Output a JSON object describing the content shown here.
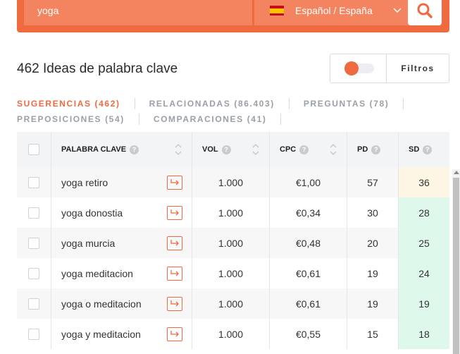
{
  "search": {
    "query": "yoga",
    "language": "Español / España",
    "flag_icon": "spain-flag-icon",
    "accent_color": "#f06a3f"
  },
  "header": {
    "ideas_title": "462 Ideas de palabra clave",
    "filters_label": "Filtros"
  },
  "tabs": [
    {
      "label": "SUGERENCIAS (462)",
      "active": true
    },
    {
      "label": "RELACIONADAS (86.403)",
      "active": false
    },
    {
      "label": "PREGUNTAS (78)",
      "active": false
    },
    {
      "label": "PREPOSICIONES (54)",
      "active": false
    },
    {
      "label": "COMPARACIONES (41)",
      "active": false
    }
  ],
  "table": {
    "columns": {
      "keyword": "PALABRA CLAVE",
      "vol": "VOL",
      "cpc": "CPC",
      "pd": "PD",
      "sd": "SD"
    },
    "help_glyph": "?",
    "rows": [
      {
        "keyword": "yoga retiro",
        "vol": "1.000",
        "cpc": "€1,00",
        "pd": "57",
        "sd": "36"
      },
      {
        "keyword": "yoga donostia",
        "vol": "1.000",
        "cpc": "€0,34",
        "pd": "30",
        "sd": "28"
      },
      {
        "keyword": "yoga murcia",
        "vol": "1.000",
        "cpc": "€0,48",
        "pd": "20",
        "sd": "25"
      },
      {
        "keyword": "yoga meditacion",
        "vol": "1.000",
        "cpc": "€0,61",
        "pd": "19",
        "sd": "24"
      },
      {
        "keyword": "yoga o meditacion",
        "vol": "1.000",
        "cpc": "€0,61",
        "pd": "19",
        "sd": "19"
      },
      {
        "keyword": "yoga y meditacion",
        "vol": "1.000",
        "cpc": "€0,55",
        "pd": "15",
        "sd": "18"
      }
    ]
  }
}
